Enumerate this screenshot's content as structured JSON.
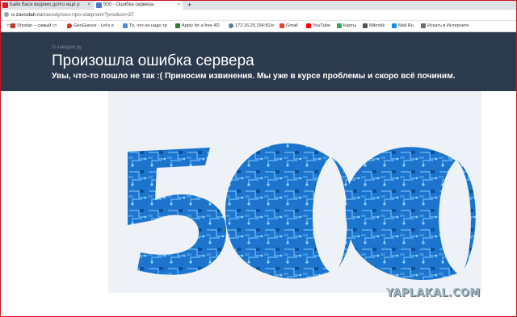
{
  "browser": {
    "tabs": [
      {
        "label": "Байк Вася видимо долго ещё р"
      },
      {
        "label": "500 - Ошибка сервера"
      }
    ],
    "new_tab_symbol": "+",
    "close_symbol": "×",
    "address": {
      "host": "o-zavodah.ru",
      "path": "/zavody/ooo-npo-statprom/?product=37"
    },
    "bookmarks": [
      {
        "label": "cw",
        "color": "#1a73e8"
      },
      {
        "label": "Shodan – самый ст",
        "color": "#c0392b"
      },
      {
        "label": "GeoGuessr - Let's e",
        "color": "#d93025"
      },
      {
        "label": "То, что не надо тр",
        "color": "#4a90d9"
      },
      {
        "label": "Apply for a free 4D",
        "color": "#2e7d32"
      },
      {
        "label": "172.16.25.154:81/e",
        "color": "#607d8b"
      },
      {
        "label": "Gmail",
        "color": "#ea4335"
      },
      {
        "label": "YouTube",
        "color": "#ff0000"
      },
      {
        "label": "Карты",
        "color": "#34a853"
      },
      {
        "label": "Mikrotik",
        "color": "#555555"
      },
      {
        "label": "Mail.Ru",
        "color": "#168de2"
      },
      {
        "label": "Искать в Интернете",
        "color": "#6b6b6b"
      }
    ]
  },
  "page": {
    "site_name": "O-заводах.ру",
    "title": "Произошла ошибка сервера",
    "subtitle": "Увы, что-то пошло не так :( Приносим извинения. Мы уже в курсе проблемы и скоро всё починим.",
    "header_color": "#2c3a4d",
    "illustration_text": "500",
    "illustration_color": "#1f78d1"
  },
  "watermark": "YAPLAKAL.COM"
}
